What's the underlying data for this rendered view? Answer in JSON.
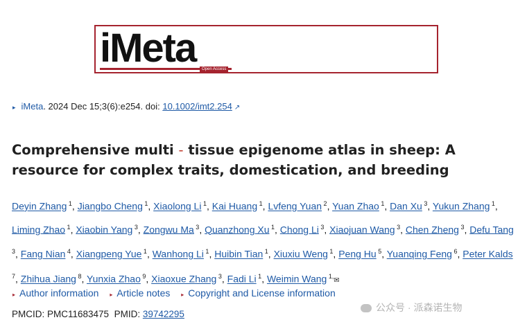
{
  "journal": {
    "logo_text": "iMeta",
    "logo_badge": "Open Access",
    "brand_color": "#a5232e",
    "link_color": "#1f5aa6"
  },
  "citation": {
    "journal_link": "iMeta",
    "details": ". 2024 Dec 15;3(6):e254. doi: ",
    "doi": "10.1002/imt2.254"
  },
  "article": {
    "title_part1": "Comprehensive multi",
    "title_sep": "‐",
    "title_part2": "tissue epigenome atlas in sheep: A resource for complex traits, domestication, and breeding"
  },
  "authors": [
    {
      "name": "Deyin Zhang",
      "aff": "1"
    },
    {
      "name": "Jiangbo Cheng",
      "aff": "1"
    },
    {
      "name": "Xiaolong Li",
      "aff": "1"
    },
    {
      "name": "Kai Huang",
      "aff": "1"
    },
    {
      "name": "Lvfeng Yuan",
      "aff": "2"
    },
    {
      "name": "Yuan Zhao",
      "aff": "1"
    },
    {
      "name": "Dan Xu",
      "aff": "3"
    },
    {
      "name": "Yukun Zhang",
      "aff": "1"
    },
    {
      "name": "Liming Zhao",
      "aff": "1"
    },
    {
      "name": "Xiaobin Yang",
      "aff": "3"
    },
    {
      "name": "Zongwu Ma",
      "aff": "3"
    },
    {
      "name": "Quanzhong Xu",
      "aff": "1"
    },
    {
      "name": "Chong Li",
      "aff": "3"
    },
    {
      "name": "Xiaojuan Wang",
      "aff": "3"
    },
    {
      "name": "Chen Zheng",
      "aff": "3"
    },
    {
      "name": "Defu Tang",
      "aff": "3"
    },
    {
      "name": "Fang Nian",
      "aff": "4"
    },
    {
      "name": "Xiangpeng Yue",
      "aff": "1"
    },
    {
      "name": "Wanhong Li",
      "aff": "1"
    },
    {
      "name": "Huibin Tian",
      "aff": "1"
    },
    {
      "name": "Xiuxiu Weng",
      "aff": "1"
    },
    {
      "name": "Peng Hu",
      "aff": "5"
    },
    {
      "name": "Yuanqing Feng",
      "aff": "6"
    },
    {
      "name": "Peter Kalds",
      "aff": "7"
    },
    {
      "name": "Zhihua Jiang",
      "aff": "8"
    },
    {
      "name": "Yunxia Zhao",
      "aff": "9"
    },
    {
      "name": "Xiaoxue Zhang",
      "aff": "3"
    },
    {
      "name": "Fadi Li",
      "aff": "1"
    },
    {
      "name": "Weimin Wang",
      "aff": "1,"
    }
  ],
  "expanders": {
    "author_info": "Author information",
    "article_notes": "Article notes",
    "copyright": "Copyright and License information"
  },
  "ids": {
    "pmcid_label": "PMCID: PMC11683475",
    "pmid_label": "PMID: ",
    "pmid": "39742295"
  },
  "watermark": {
    "text": "公众号 · 派森诺生物"
  }
}
